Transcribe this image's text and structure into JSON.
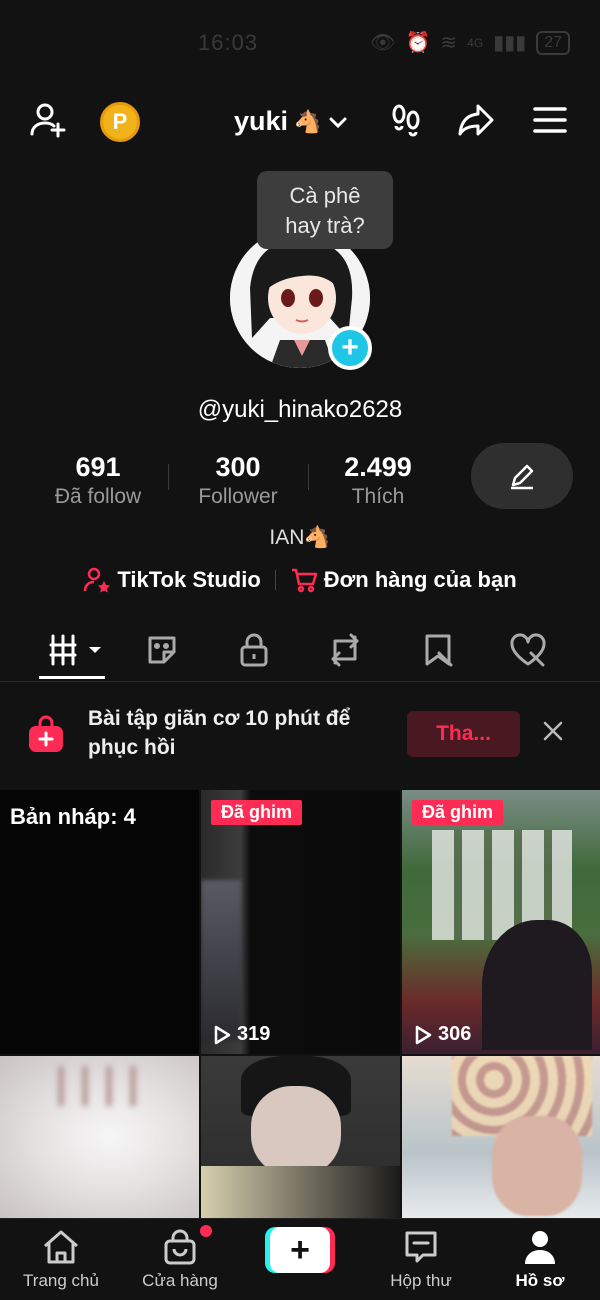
{
  "status": {
    "time": "16:03",
    "signal": "4G",
    "battery": "27"
  },
  "header": {
    "username": "yuki",
    "username_emoji": "🐴",
    "coin_letter": "P"
  },
  "profile": {
    "note": "Cà phê hay trà?",
    "note_line1": "Cà phê",
    "note_line2": "hay trà?",
    "handle": "@yuki_hinako2628",
    "bio": "IAN🐴",
    "stats": [
      {
        "value": "691",
        "label": "Đã follow"
      },
      {
        "value": "300",
        "label": "Follower"
      },
      {
        "value": "2.499",
        "label": "Thích"
      }
    ],
    "links": {
      "studio": "TikTok Studio",
      "orders": "Đơn hàng của bạn"
    }
  },
  "tabs": [
    "videos-tab",
    "stickers-tab",
    "private-tab",
    "repost-tab",
    "favorites-tab",
    "liked-tab"
  ],
  "promo": {
    "text": "Bài tập giãn cơ 10 phút để phục hồi",
    "button": "Tha..."
  },
  "grid": [
    {
      "type": "draft",
      "label": "Bản nháp: 4"
    },
    {
      "type": "pinned",
      "badge": "Đã ghim",
      "views": "319"
    },
    {
      "type": "pinned",
      "badge": "Đã ghim",
      "views": "306"
    },
    {
      "type": "video"
    },
    {
      "type": "video"
    },
    {
      "type": "video"
    }
  ],
  "bottom_nav": [
    {
      "label": "Trang chủ"
    },
    {
      "label": "Cửa hàng"
    },
    {
      "label": ""
    },
    {
      "label": "Hộp thư"
    },
    {
      "label": "Hồ sơ"
    }
  ],
  "colors": {
    "accent": "#fe2c55",
    "cyan": "#25f4ee",
    "background": "#121212"
  }
}
